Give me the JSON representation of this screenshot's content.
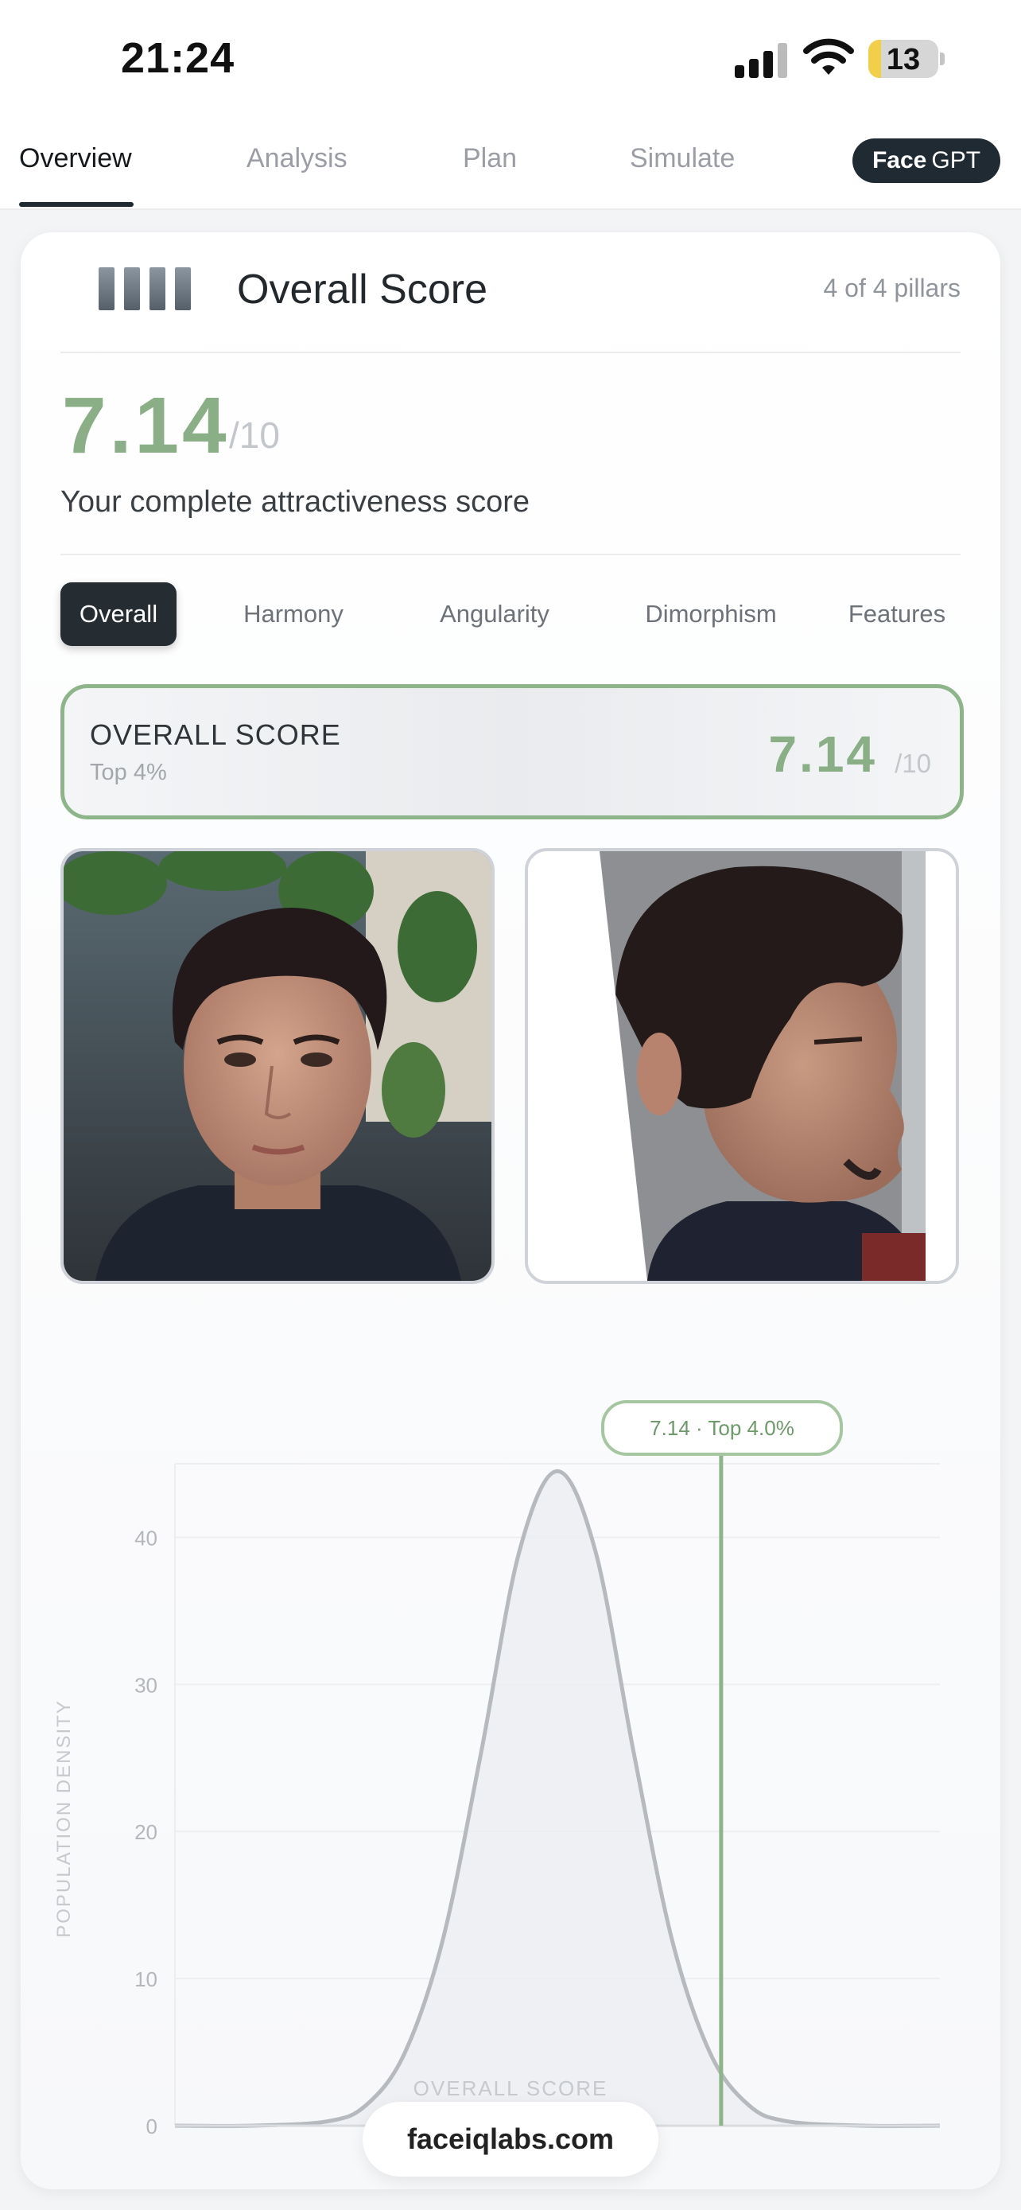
{
  "status_bar": {
    "time": "21:24",
    "battery_level": "13"
  },
  "tabs": {
    "items": [
      {
        "label": "Overview",
        "active": true
      },
      {
        "label": "Analysis"
      },
      {
        "label": "Plan"
      },
      {
        "label": "Simulate"
      }
    ],
    "face_gpt": {
      "bold": "Face",
      "rest": "GPT"
    }
  },
  "card": {
    "title": "Overall Score",
    "pillars": "4 of 4 pillars",
    "score": "7.14",
    "denominator": "/10",
    "subtitle": "Your complete attractiveness score",
    "segments": [
      "Overall",
      "Harmony",
      "Angularity",
      "Dimorphism",
      "Features"
    ],
    "active_segment": "Overall",
    "summary": {
      "label": "OVERALL SCORE",
      "percentile": "Top 4%",
      "score": "7.14",
      "denominator": "/10"
    }
  },
  "photos": {
    "front": "front-face-photo",
    "side": "side-profile-photo"
  },
  "chart_data": {
    "type": "area",
    "callout": "7.14 · Top 4.0%",
    "ylabel": "POPULATION DENSITY",
    "xlabel": "OVERALL SCORE",
    "xlim": [
      0,
      10
    ],
    "ylim": [
      0,
      45
    ],
    "xticks": [
      "0",
      "1",
      "2",
      "3",
      "4",
      "5",
      "6",
      "7",
      "8",
      "9",
      "10"
    ],
    "yticks": [
      "0",
      "10",
      "20",
      "30",
      "40"
    ],
    "series": [
      {
        "x": [
          0,
          1,
          2,
          2.5,
          3,
          3.5,
          4,
          4.5,
          5,
          5.5,
          6,
          6.5,
          7,
          7.5,
          8,
          9,
          10
        ],
        "values": [
          0,
          0,
          0.3,
          1.4,
          4.9,
          12.6,
          25.3,
          39,
          44.5,
          39,
          25.3,
          12.6,
          4.9,
          1.4,
          0.3,
          0,
          0
        ]
      }
    ],
    "marker": {
      "x": 7.14
    },
    "grid": true,
    "colors": {
      "curve": "#b6babf",
      "fill": "#eceef1",
      "marker": "#8eb48a"
    }
  },
  "footer": {
    "site": "faceiqlabs.com"
  }
}
